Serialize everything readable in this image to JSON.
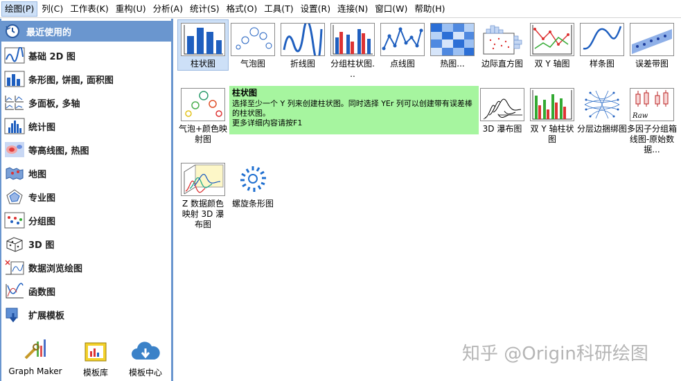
{
  "menu": [
    {
      "label": "绘图(P)"
    },
    {
      "label": "列(C)"
    },
    {
      "label": "工作表(K)"
    },
    {
      "label": "重构(U)"
    },
    {
      "label": "分析(A)"
    },
    {
      "label": "统计(S)"
    },
    {
      "label": "格式(O)"
    },
    {
      "label": "工具(T)"
    },
    {
      "label": "设置(R)"
    },
    {
      "label": "连接(N)"
    },
    {
      "label": "窗口(W)"
    },
    {
      "label": "帮助(H)"
    }
  ],
  "sidebar": {
    "items": [
      {
        "label": "最近使用的",
        "icon": "clock-icon"
      },
      {
        "label": "基础 2D 图",
        "icon": "line-chart-icon"
      },
      {
        "label": "条形图, 饼图, 面积图",
        "icon": "bar-chart-icon"
      },
      {
        "label": "多面板, 多轴",
        "icon": "multi-panel-icon"
      },
      {
        "label": "统计图",
        "icon": "histogram-icon"
      },
      {
        "label": "等高线图, 热图",
        "icon": "contour-icon"
      },
      {
        "label": "地图",
        "icon": "map-icon"
      },
      {
        "label": "专业图",
        "icon": "radar-icon"
      },
      {
        "label": "分组图",
        "icon": "grouped-scatter-icon"
      },
      {
        "label": "3D 图",
        "icon": "3d-icon"
      },
      {
        "label": "数据浏览绘图",
        "icon": "data-explore-icon"
      },
      {
        "label": "函数图",
        "icon": "function-icon"
      },
      {
        "label": "扩展模板",
        "icon": "extension-icon"
      }
    ],
    "bottom": [
      {
        "label": "Graph Maker",
        "icon": "graph-maker-icon"
      },
      {
        "label": "模板库",
        "icon": "template-library-icon"
      },
      {
        "label": "模板中心",
        "icon": "template-center-icon"
      }
    ]
  },
  "gallery": {
    "tiles": [
      {
        "label": "柱状图",
        "icon": "column-chart-icon"
      },
      {
        "label": "气泡图",
        "icon": "bubble-chart-icon"
      },
      {
        "label": "折线图",
        "icon": "line-plot-icon"
      },
      {
        "label": "分组柱状图. ..",
        "icon": "grouped-column-icon"
      },
      {
        "label": "点线图",
        "icon": "line-symbol-icon"
      },
      {
        "label": "热图...",
        "icon": "heatmap-icon"
      },
      {
        "label": "边际直方图",
        "icon": "marginal-histogram-icon"
      },
      {
        "label": "双 Y 轴图",
        "icon": "double-y-icon"
      },
      {
        "label": "样条图",
        "icon": "spline-icon"
      },
      {
        "label": "误差带图",
        "icon": "error-band-icon"
      },
      {
        "label": "气泡+颜色映射图",
        "icon": "bubble-color-icon"
      },
      {
        "label": "3D 瀑布图",
        "icon": "waterfall-3d-icon"
      },
      {
        "label": "双 Y 轴柱状图",
        "icon": "double-y-column-icon"
      },
      {
        "label": "分层边捆绑图",
        "icon": "edge-bundling-icon"
      },
      {
        "label": "多因子分组箱线图-原始数据...",
        "icon": "multi-factor-box-icon"
      },
      {
        "label": "Z 数据颜色映射 3D 瀑布图",
        "icon": "z-color-waterfall-icon"
      },
      {
        "label": "螺旋条形图",
        "icon": "spiral-bar-icon"
      }
    ]
  },
  "tooltip": {
    "title": "柱状图",
    "line1": "选择至少一个 Y 列来创建柱状图。同时选择 YEr 列可以创建带有误差棒的柱状图。",
    "line2": "更多详细内容请按F1"
  },
  "watermark": "知乎 @Origin科研绘图",
  "colors": {
    "sidebar_accent": "#6a96cf",
    "selection": "#cde0f7",
    "tooltip_bg": "#a6f59f",
    "chart_blue": "#1f5fbf"
  }
}
